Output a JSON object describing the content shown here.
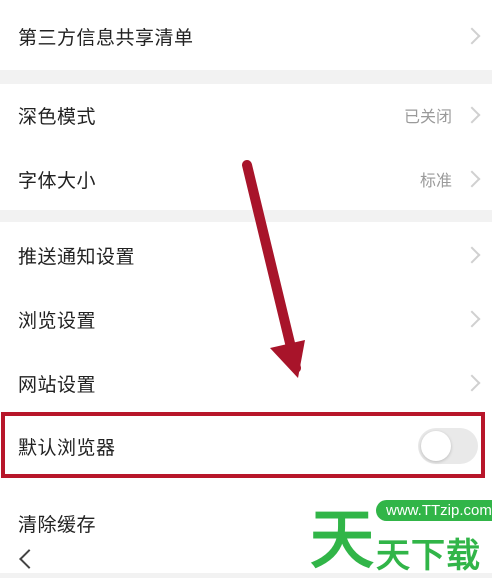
{
  "settings": {
    "rows": [
      {
        "label": "第三方信息共享清单",
        "value": ""
      },
      {
        "label": "深色模式",
        "value": "已关闭"
      },
      {
        "label": "字体大小",
        "value": "标准"
      },
      {
        "label": "推送通知设置",
        "value": ""
      },
      {
        "label": "浏览设置",
        "value": ""
      },
      {
        "label": "网站设置",
        "value": ""
      },
      {
        "label": "默认浏览器",
        "value": ""
      },
      {
        "label": "清除缓存",
        "value": ""
      }
    ],
    "default_browser_toggle": "off"
  },
  "annotation": {
    "highlight_color": "#b8162a",
    "arrow_color": "#a8142a"
  },
  "watermark": {
    "big_char": "天",
    "url": "www.TTzip.com",
    "text": "天下载",
    "color": "#31b548"
  },
  "nav": {
    "back_icon": "chevron-left-icon"
  }
}
